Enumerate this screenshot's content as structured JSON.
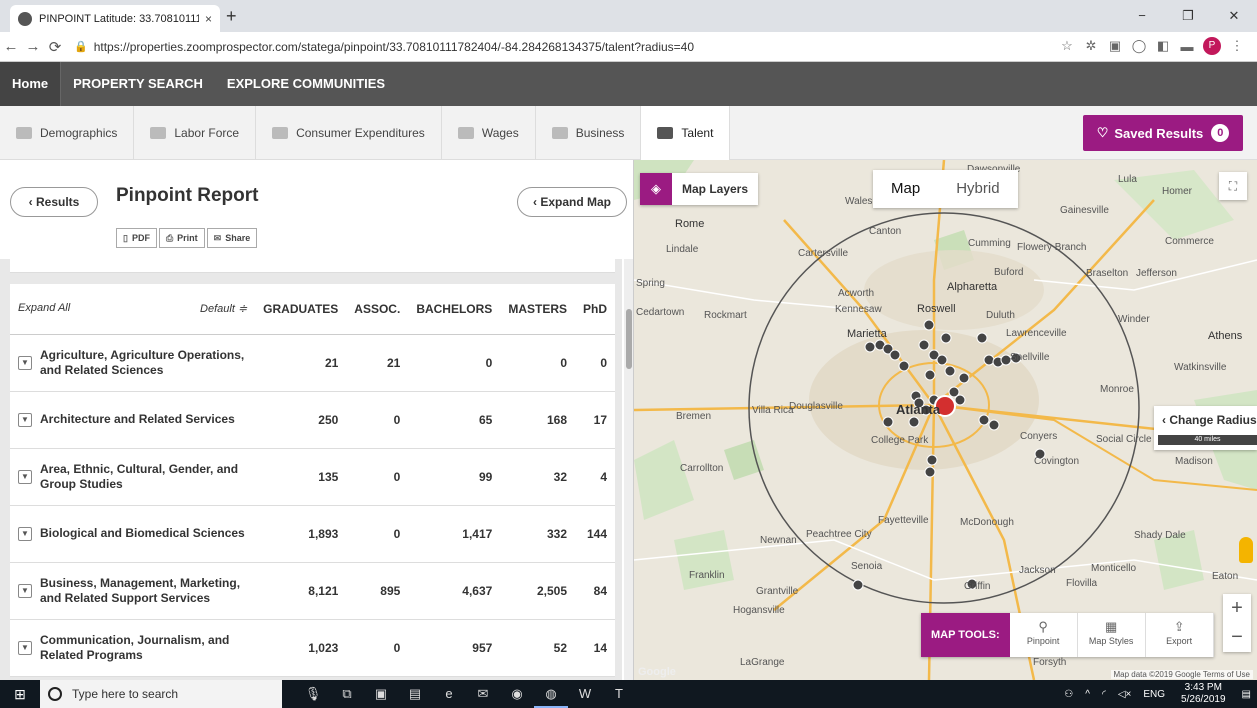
{
  "browser": {
    "tab_title": "PINPOINT Latitude: 33.70810111",
    "tab_close": "×",
    "new_tab": "+",
    "url": "https://properties.zoomprospector.com/statega/pinpoint/33.70810111782404/-84.284268134375/talent?radius=40",
    "window_controls": [
      "−",
      "❐",
      "✕"
    ]
  },
  "sitenav": {
    "items": [
      "Home",
      "PROPERTY SEARCH",
      "EXPLORE COMMUNITIES"
    ]
  },
  "category_tabs": [
    {
      "label": "Demographics",
      "icon": "pie-chart-icon",
      "active": false
    },
    {
      "label": "Labor Force",
      "icon": "gears-icon",
      "active": false
    },
    {
      "label": "Consumer Expenditures",
      "icon": "register-icon",
      "active": false
    },
    {
      "label": "Wages",
      "icon": "cash-icon",
      "active": false
    },
    {
      "label": "Business",
      "icon": "briefcase-icon",
      "active": false
    },
    {
      "label": "Talent",
      "icon": "institution-icon",
      "active": true
    }
  ],
  "saved_results": {
    "label": "Saved Results",
    "count": "0"
  },
  "panel": {
    "results_label": "Results",
    "title": "Pinpoint Report",
    "expand_map_label": "Expand Map",
    "actions": [
      "PDF",
      "Print",
      "Share"
    ]
  },
  "table": {
    "expand_all": "Expand All",
    "default_sort": "Default ≑",
    "columns": [
      "GRADUATES",
      "ASSOC.",
      "BACHELORS",
      "MASTERS",
      "PhD"
    ],
    "rows": [
      {
        "label": "Agriculture, Agriculture Operations, and Related Sciences",
        "values": [
          "21",
          "21",
          "0",
          "0",
          "0"
        ]
      },
      {
        "label": "Architecture and Related Services",
        "values": [
          "250",
          "0",
          "65",
          "168",
          "17"
        ]
      },
      {
        "label": "Area, Ethnic, Cultural, Gender, and Group Studies",
        "values": [
          "135",
          "0",
          "99",
          "32",
          "4"
        ]
      },
      {
        "label": "Biological and Biomedical Sciences",
        "values": [
          "1,893",
          "0",
          "1,417",
          "332",
          "144"
        ]
      },
      {
        "label": "Business, Management, Marketing, and Related Support Services",
        "values": [
          "8,121",
          "895",
          "4,637",
          "2,505",
          "84"
        ]
      },
      {
        "label": "Communication, Journalism, and Related Programs",
        "values": [
          "1,023",
          "0",
          "957",
          "52",
          "14"
        ]
      }
    ]
  },
  "map": {
    "layers_label": "Map Layers",
    "type_map": "Map",
    "type_hybrid": "Hybrid",
    "change_radius": "Change Radius",
    "radius_value": "40 miles",
    "tools_label": "MAP TOOLS:",
    "tools": [
      "Pinpoint",
      "Map Styles",
      "Export"
    ],
    "zoom_in": "+",
    "zoom_out": "−",
    "attribution": "Map data ©2019 Google   Terms of Use",
    "google": "Google",
    "places": [
      {
        "name": "Dawsonville"
      },
      {
        "name": "Lula"
      },
      {
        "name": "Homer"
      },
      {
        "name": "Gainesville"
      },
      {
        "name": "Waleska"
      },
      {
        "name": "Rome"
      },
      {
        "name": "Lindale"
      },
      {
        "name": "Canton"
      },
      {
        "name": "Cartersville"
      },
      {
        "name": "Cumming"
      },
      {
        "name": "Flowery Branch"
      },
      {
        "name": "Commerce"
      },
      {
        "name": "Buford"
      },
      {
        "name": "Braselton"
      },
      {
        "name": "Jefferson"
      },
      {
        "name": "Spring"
      },
      {
        "name": "Alpharetta"
      },
      {
        "name": "Acworth"
      },
      {
        "name": "Kennesaw"
      },
      {
        "name": "Roswell"
      },
      {
        "name": "Cedartown"
      },
      {
        "name": "Rockmart"
      },
      {
        "name": "Duluth"
      },
      {
        "name": "Winder"
      },
      {
        "name": "Marietta"
      },
      {
        "name": "Lawrenceville"
      },
      {
        "name": "Athens"
      },
      {
        "name": "Snellville"
      },
      {
        "name": "Watkinsville"
      },
      {
        "name": "Monroe"
      },
      {
        "name": "Douglasville"
      },
      {
        "name": "Villa Rica"
      },
      {
        "name": "Bremen"
      },
      {
        "name": "Atlanta"
      },
      {
        "name": "Conyers"
      },
      {
        "name": "Social Circle"
      },
      {
        "name": "College Park"
      },
      {
        "name": "Covington"
      },
      {
        "name": "Madison"
      },
      {
        "name": "Carrollton"
      },
      {
        "name": "Fayetteville"
      },
      {
        "name": "McDonough"
      },
      {
        "name": "Peachtree City"
      },
      {
        "name": "Newnan"
      },
      {
        "name": "Shady Dale"
      },
      {
        "name": "Senoia"
      },
      {
        "name": "Jackson"
      },
      {
        "name": "Monticello"
      },
      {
        "name": "Eaton"
      },
      {
        "name": "Franklin"
      },
      {
        "name": "Grantville"
      },
      {
        "name": "Griffin"
      },
      {
        "name": "Hogansville"
      },
      {
        "name": "Forsyth"
      },
      {
        "name": "LaGrange"
      },
      {
        "name": "Flovilla"
      }
    ]
  },
  "taskbar": {
    "search_placeholder": "Type here to search",
    "tray_lang": "ENG",
    "time": "3:43 PM",
    "date": "5/26/2019"
  },
  "colors": {
    "accent": "#9b1b82",
    "nav": "#555555"
  }
}
